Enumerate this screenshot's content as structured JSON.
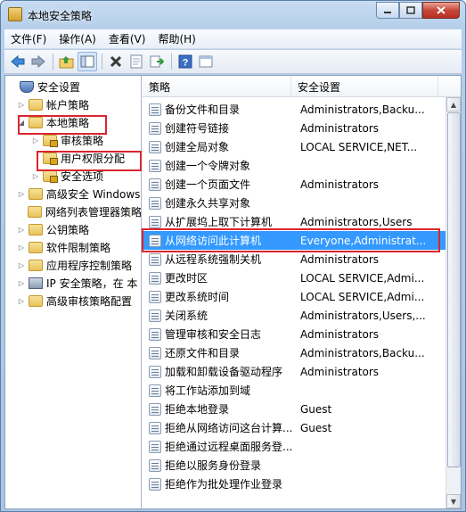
{
  "window": {
    "title": "本地安全策略"
  },
  "menu": [
    "文件(F)",
    "操作(A)",
    "查看(V)",
    "帮助(H)"
  ],
  "tree": {
    "root": "安全设置",
    "items": [
      {
        "label": "帐户策略",
        "level": 1,
        "expand": "▷",
        "icon": "folder-icon"
      },
      {
        "label": "本地策略",
        "level": 1,
        "expand": "◢",
        "icon": "folder-icon"
      },
      {
        "label": "审核策略",
        "level": 2,
        "expand": "▷",
        "icon": "folder-lock-icon"
      },
      {
        "label": "用户权限分配",
        "level": 2,
        "expand": "",
        "icon": "folder-lock-icon"
      },
      {
        "label": "安全选项",
        "level": 2,
        "expand": "▷",
        "icon": "folder-lock-icon"
      },
      {
        "label": "高级安全 Windows",
        "level": 1,
        "expand": "▷",
        "icon": "folder-icon"
      },
      {
        "label": "网络列表管理器策略",
        "level": 1,
        "expand": "",
        "icon": "folder-icon"
      },
      {
        "label": "公钥策略",
        "level": 1,
        "expand": "▷",
        "icon": "folder-icon"
      },
      {
        "label": "软件限制策略",
        "level": 1,
        "expand": "▷",
        "icon": "folder-icon"
      },
      {
        "label": "应用程序控制策略",
        "level": 1,
        "expand": "▷",
        "icon": "folder-icon"
      },
      {
        "label": "IP 安全策略，在 本",
        "level": 1,
        "expand": "▷",
        "icon": "computer-icon"
      },
      {
        "label": "高级审核策略配置",
        "level": 1,
        "expand": "▷",
        "icon": "folder-icon"
      }
    ]
  },
  "columns": {
    "policy": "策略",
    "setting": "安全设置"
  },
  "rows": [
    {
      "policy": "备份文件和目录",
      "setting": "Administrators,Backu..."
    },
    {
      "policy": "创建符号链接",
      "setting": "Administrators"
    },
    {
      "policy": "创建全局对象",
      "setting": "LOCAL SERVICE,NET..."
    },
    {
      "policy": "创建一个令牌对象",
      "setting": ""
    },
    {
      "policy": "创建一个页面文件",
      "setting": "Administrators"
    },
    {
      "policy": "创建永久共享对象",
      "setting": ""
    },
    {
      "policy": "从扩展坞上取下计算机",
      "setting": "Administrators,Users"
    },
    {
      "policy": "从网络访问此计算机",
      "setting": "Everyone,Administrat..."
    },
    {
      "policy": "从远程系统强制关机",
      "setting": "Administrators"
    },
    {
      "policy": "更改时区",
      "setting": "LOCAL SERVICE,Admi..."
    },
    {
      "policy": "更改系统时间",
      "setting": "LOCAL SERVICE,Admi..."
    },
    {
      "policy": "关闭系统",
      "setting": "Administrators,Users,..."
    },
    {
      "policy": "管理审核和安全日志",
      "setting": "Administrators"
    },
    {
      "policy": "还原文件和目录",
      "setting": "Administrators,Backu..."
    },
    {
      "policy": "加载和卸载设备驱动程序",
      "setting": "Administrators"
    },
    {
      "policy": "将工作站添加到域",
      "setting": ""
    },
    {
      "policy": "拒绝本地登录",
      "setting": "Guest"
    },
    {
      "policy": "拒绝从网络访问这台计算...",
      "setting": "Guest"
    },
    {
      "policy": "拒绝通过远程桌面服务登...",
      "setting": ""
    },
    {
      "policy": "拒绝以服务身份登录",
      "setting": ""
    },
    {
      "policy": "拒绝作为批处理作业登录",
      "setting": ""
    }
  ],
  "selected_row": 7
}
